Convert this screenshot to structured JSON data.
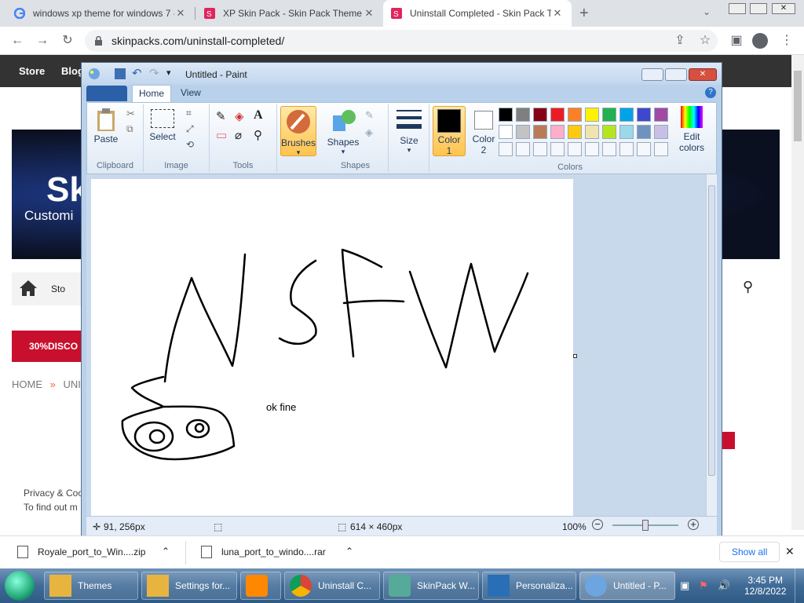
{
  "browser": {
    "tabs": [
      {
        "title": "windows xp theme for windows 7 -",
        "active": false
      },
      {
        "title": "XP Skin Pack - Skin Pack Theme for",
        "active": false
      },
      {
        "title": "Uninstall Completed - Skin Pack The",
        "active": true
      }
    ],
    "url": "skinpacks.com/uninstall-completed/",
    "new_tab": "+"
  },
  "webpage": {
    "nav": [
      "Store",
      "Blog"
    ],
    "banner_text": "Sk",
    "banner_sub": "Customi",
    "promo": "30%DISCO",
    "breadcrumb": "HOME",
    "breadcrumb_sep": "»",
    "breadcrumb_next": "UNI",
    "cookie_text": "Privacy & Coo",
    "cookie_text2": "To find out m",
    "store_label": "Sto"
  },
  "paint": {
    "title": "Untitled - Paint",
    "tabs": [
      "Home",
      "View"
    ],
    "groups": {
      "clipboard": "Clipboard",
      "image": "Image",
      "tools": "Tools",
      "shapes": "Shapes",
      "colors": "Colors"
    },
    "buttons": {
      "paste": "Paste",
      "select": "Select",
      "brushes": "Brushes",
      "shapes": "Shapes",
      "size": "Size",
      "color1": "Color",
      "color1_num": "1",
      "color2": "Color",
      "color2_num": "2",
      "edit_colors": "Edit",
      "edit_colors2": "colors"
    },
    "palette": [
      "#000000",
      "#7f7f7f",
      "#880015",
      "#ed1c24",
      "#ff7f27",
      "#fff200",
      "#22b14c",
      "#00a2e8",
      "#3f48cc",
      "#a349a4",
      "#ffffff",
      "#c3c3c3",
      "#b97a57",
      "#ffaec9",
      "#ffc90e",
      "#efe4b0",
      "#b5e61d",
      "#99d9ea",
      "#7092be",
      "#c8bfe7"
    ],
    "canvas_text": "ok fine",
    "status": {
      "cursor": "91, 256px",
      "size": "614 × 460px",
      "zoom": "100%"
    }
  },
  "downloads": [
    {
      "name": "Royale_port_to_Win....zip"
    },
    {
      "name": "luna_port_to_windo....rar"
    }
  ],
  "show_all": "Show all",
  "taskbar": {
    "items": [
      "Themes",
      "Settings for...",
      "",
      "Uninstall C...",
      "SkinPack W...",
      "Personaliza...",
      "Untitled - P..."
    ],
    "time": "3:45 PM",
    "date": "12/8/2022"
  }
}
